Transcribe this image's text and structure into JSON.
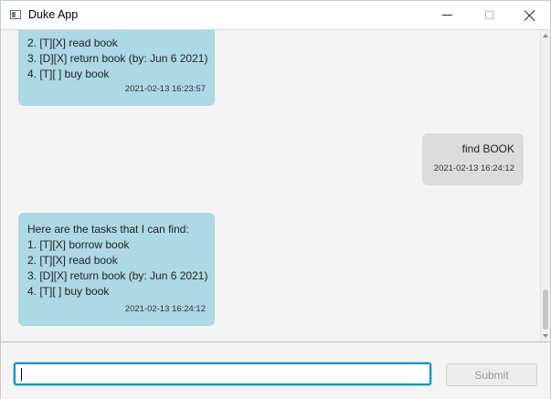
{
  "window": {
    "title": "Duke App"
  },
  "chat": {
    "messages": [
      {
        "sender": "duke",
        "lines": [
          "2. [T][X] read book",
          "3. [D][X] return book (by: Jun 6 2021)",
          "4. [T][ ] buy book"
        ],
        "timestamp": "2021-02-13 16:23:57"
      },
      {
        "sender": "user",
        "lines": [
          "find BOOK"
        ],
        "timestamp": "2021-02-13 16:24:12"
      },
      {
        "sender": "duke",
        "lines": [
          "Here are the tasks that I can find:",
          "1. [T][X] borrow book",
          "2. [T][X] read book",
          "3. [D][X] return book (by: Jun 6 2021)",
          "4. [T][ ] buy book"
        ],
        "timestamp": "2021-02-13 16:24:12"
      }
    ]
  },
  "input": {
    "value": "",
    "placeholder": ""
  },
  "submit": {
    "label": "Submit"
  },
  "colors": {
    "duke_bubble": "#add8e6",
    "user_bubble": "#dcdcdc",
    "focus_border": "#0096c9"
  }
}
